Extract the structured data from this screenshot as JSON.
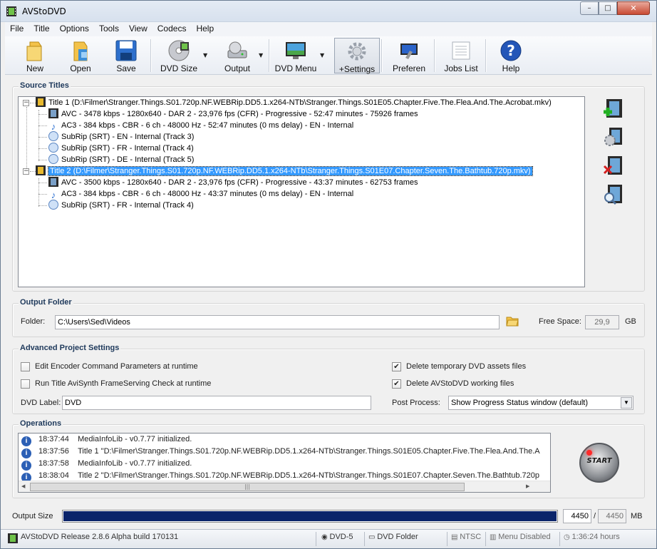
{
  "window": {
    "title": "AVStoDVD",
    "min": "–",
    "max": "□",
    "close": "✕"
  },
  "menu": [
    "File",
    "Title",
    "Options",
    "Tools",
    "View",
    "Codecs",
    "Help"
  ],
  "toolbar": {
    "new": "New",
    "open": "Open",
    "save": "Save",
    "dvd_size": "DVD Size",
    "output": "Output",
    "dvd_menu": "DVD Menu",
    "settings": "+Settings",
    "preferences": "Preferen",
    "jobs": "Jobs List",
    "help": "Help"
  },
  "source": {
    "title": "Source Titles",
    "rows": [
      "Title 1 (D:\\Filmer\\Stranger.Things.S01.720p.NF.WEBRip.DD5.1.x264-NTb\\Stranger.Things.S01E05.Chapter.Five.The.Flea.And.The.Acrobat.mkv)",
      "AVC - 3478 kbps - 1280x640 - DAR 2 - 23,976 fps (CFR) - Progressive - 52:47 minutes - 75926 frames",
      "AC3 - 384 kbps - CBR - 6 ch - 48000 Hz - 52:47 minutes (0 ms delay) - EN - Internal",
      "SubRip (SRT) - EN - Internal (Track 3)",
      "SubRip (SRT) - FR - Internal (Track 4)",
      "SubRip (SRT) - DE - Internal (Track 5)",
      "Title 2 (D:\\Filmer\\Stranger.Things.S01.720p.NF.WEBRip.DD5.1.x264-NTb\\Stranger.Things.S01E07.Chapter.Seven.The.Bathtub.720p.mkv)",
      "AVC - 3500 kbps - 1280x640 - DAR 2 - 23,976 fps (CFR) - Progressive - 43:37 minutes - 62753 frames",
      "AC3 - 384 kbps - CBR - 6 ch - 48000 Hz - 43:37 minutes (0 ms delay) - EN - Internal",
      "SubRip (SRT) - FR - Internal (Track 4)"
    ]
  },
  "output_folder": {
    "title": "Output Folder",
    "folder_label": "Folder:",
    "folder_value": "C:\\Users\\Sed\\Videos",
    "free_label": "Free Space:",
    "free_value": "29,9",
    "free_unit": "GB"
  },
  "advanced": {
    "title": "Advanced Project Settings",
    "edit_encoder": "Edit Encoder Command Parameters at runtime",
    "run_avisynth": "Run Title AviSynth FrameServing Check at runtime",
    "delete_temp": "Delete temporary DVD assets files",
    "delete_working": "Delete AVStoDVD working files",
    "dvd_label": "DVD Label:",
    "dvd_label_value": "DVD",
    "post_process": "Post Process:",
    "post_process_value": "Show Progress Status window (default)"
  },
  "operations": {
    "title": "Operations",
    "rows": [
      {
        "time": "18:37:44",
        "msg": "MediaInfoLib - v0.7.77 initialized."
      },
      {
        "time": "18:37:56",
        "msg": "Title 1 \"D:\\Filmer\\Stranger.Things.S01.720p.NF.WEBRip.DD5.1.x264-NTb\\Stranger.Things.S01E05.Chapter.Five.The.Flea.And.The.A"
      },
      {
        "time": "18:37:58",
        "msg": "MediaInfoLib - v0.7.77 initialized."
      },
      {
        "time": "18:38:04",
        "msg": "Title 2 \"D:\\Filmer\\Stranger.Things.S01.720p.NF.WEBRip.DD5.1.x264-NTb\\Stranger.Things.S01E07.Chapter.Seven.The.Bathtub.720p"
      }
    ],
    "start": "START"
  },
  "output_size": {
    "label": "Output Size",
    "value": "4450",
    "slash": "/",
    "total": "4450",
    "unit": "MB",
    "fill_fraction": 1.0
  },
  "status": {
    "release": "AVStoDVD Release 2.8.6 Alpha build 170131",
    "dvd": "DVD-5",
    "folder": "DVD Folder",
    "ntsc": "NTSC",
    "menu": "Menu Disabled",
    "duration": "1:36:24 hours"
  },
  "colors": {
    "progress": "#0a246a",
    "selection": "#3399ff",
    "group_title": "#1e395b"
  }
}
